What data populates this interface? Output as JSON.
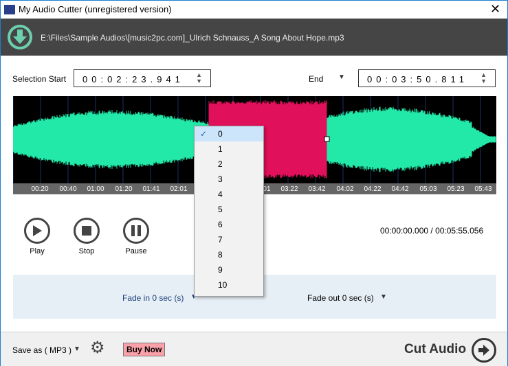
{
  "window": {
    "title": "My Audio Cutter (unregistered version)",
    "close": "✕"
  },
  "header": {
    "file_path": "E:\\Files\\Sample Audios\\[music2pc.com]_Ulrich Schnauss_A Song About Hope.mp3"
  },
  "selection": {
    "start_label": "Selection Start",
    "start_value": "00:02:23.941",
    "end_label": "End",
    "end_value": "00:03:50.811"
  },
  "timeline": {
    "labels": [
      "00:20",
      "00:40",
      "01:00",
      "01:20",
      "01:41",
      "02:01",
      "03:01",
      "03:22",
      "03:42",
      "04:02",
      "04:22",
      "04:42",
      "05:03",
      "05:23",
      "05:43"
    ]
  },
  "colors": {
    "waveform": "#22e8a8",
    "selection": "#e0105a",
    "background": "#000000"
  },
  "controls": {
    "play": "Play",
    "stop": "Stop",
    "pause": "Pause",
    "position": "00:00:00.000 / 00:05:55.056"
  },
  "fade": {
    "fade_in": "Fade in 0 sec (s)",
    "fade_out": "Fade out 0 sec (s)"
  },
  "dropdown": {
    "options": [
      "0",
      "1",
      "2",
      "3",
      "4",
      "5",
      "6",
      "7",
      "8",
      "9",
      "10"
    ],
    "selected": "0"
  },
  "bottom": {
    "save_as": "Save as ( MP3 )",
    "buy_now": "Buy Now",
    "cut_audio": "Cut Audio"
  }
}
